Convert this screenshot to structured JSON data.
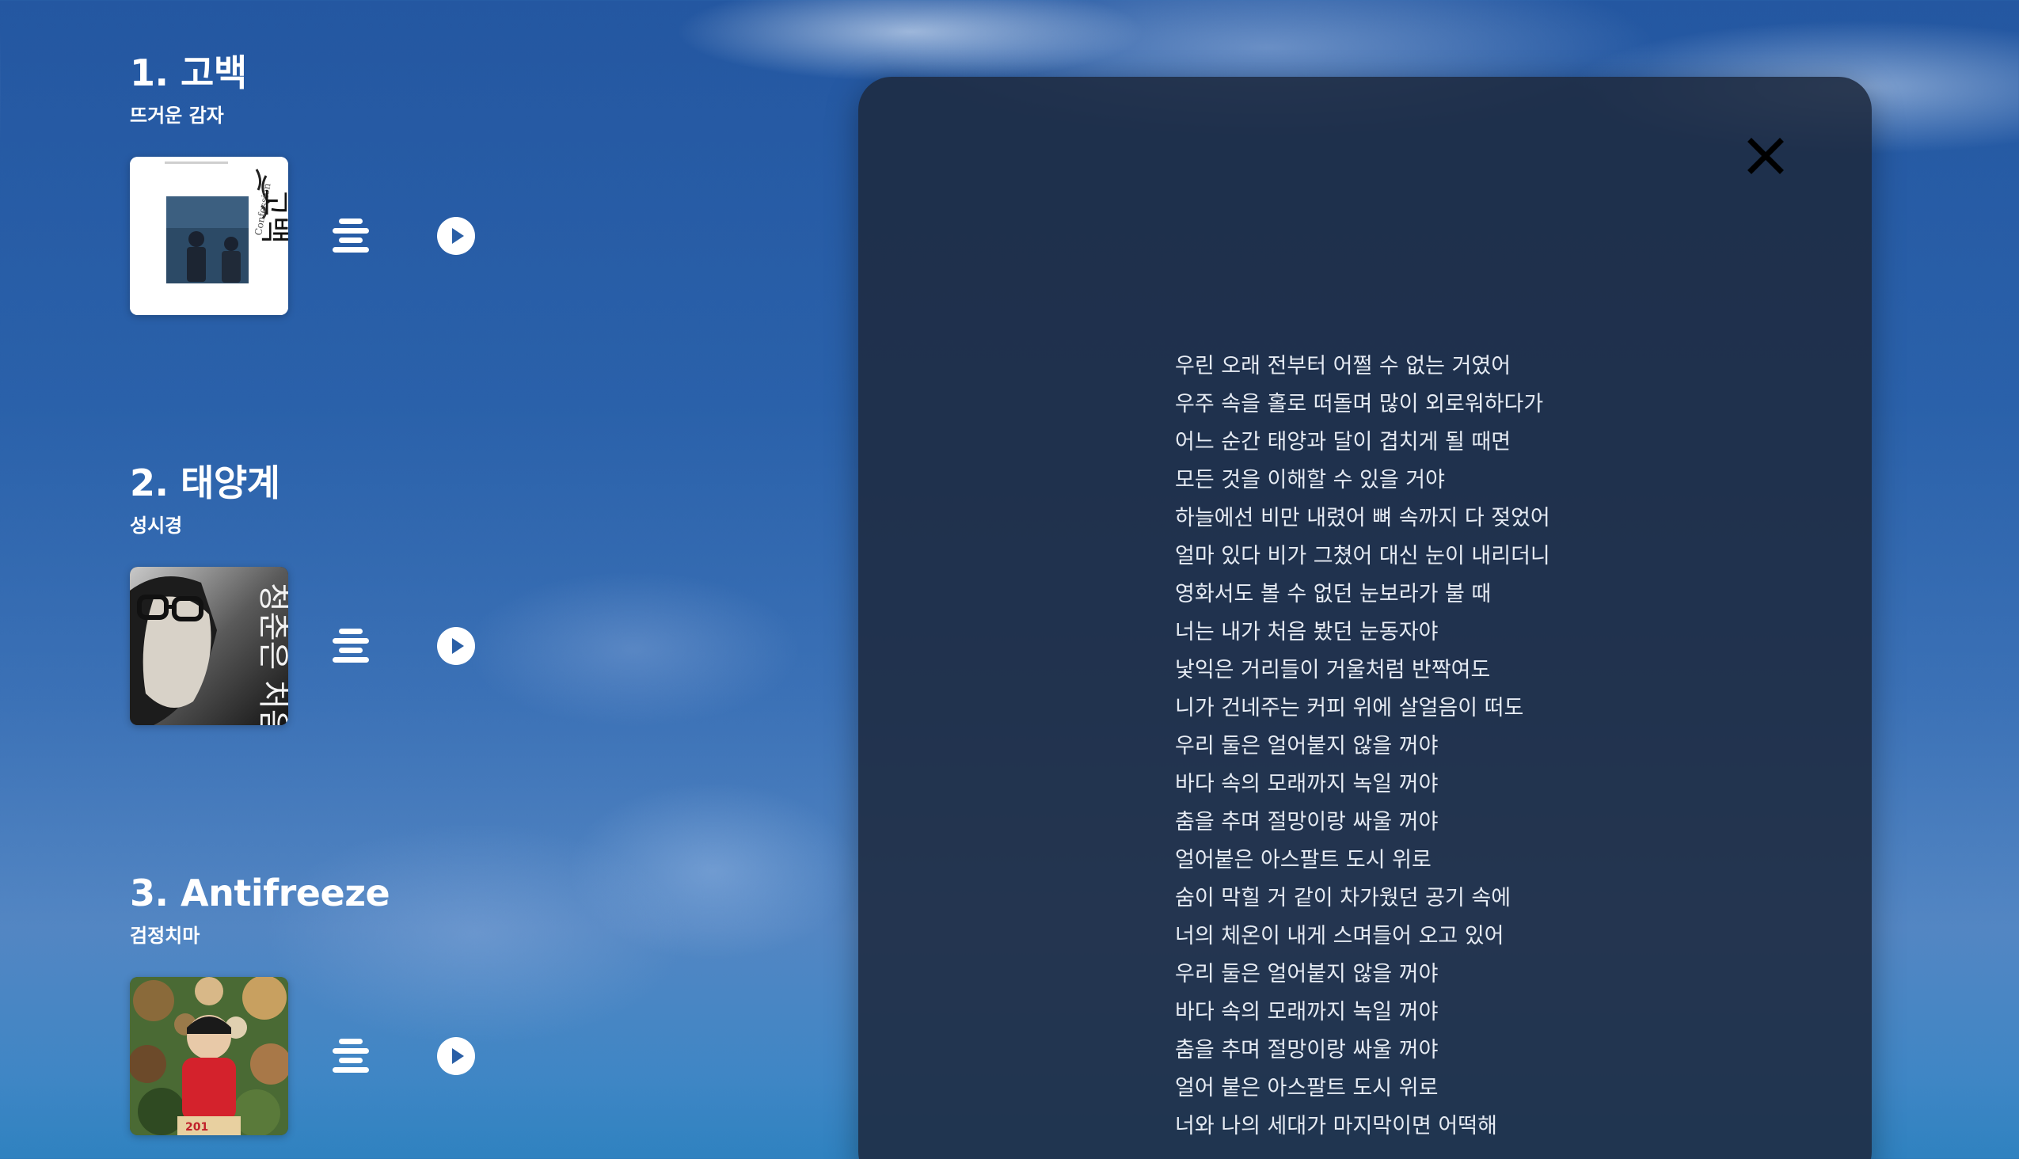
{
  "songs": [
    {
      "title": "1. 고백",
      "artist": "뜨거운 감자",
      "album_text": "고백",
      "album_subtext": "Confession",
      "lyrics_icon": "lyrics-lines-icon",
      "play_icon": "play-icon"
    },
    {
      "title": "2. 태양계",
      "artist": "성시경",
      "album_text": "청춘은 처음",
      "lyrics_icon": "lyrics-lines-icon",
      "play_icon": "play-icon"
    },
    {
      "title": "3. Antifreeze",
      "artist": "검정치마",
      "album_text": "201",
      "lyrics_icon": "lyrics-lines-icon",
      "play_icon": "play-icon"
    }
  ],
  "lyrics_panel": {
    "close_icon": "close-icon",
    "lines": [
      "우린 오래 전부터 어쩔 수 없는 거였어",
      "우주 속을 홀로 떠돌며 많이 외로워하다가",
      "어느 순간 태양과 달이 겹치게 될 때면",
      "모든 것을 이해할 수 있을 거야",
      "하늘에선 비만 내렸어 뼈 속까지 다 젖었어",
      "얼마 있다 비가 그쳤어 대신 눈이 내리더니",
      "영화서도 볼 수 없던 눈보라가 불 때",
      "너는 내가 처음 봤던 눈동자야",
      "낯익은 거리들이 거울처럼 반짝여도",
      "니가 건네주는 커피 위에 살얼음이 떠도",
      "우리 둘은 얼어붙지 않을 꺼야",
      "바다 속의 모래까지 녹일 꺼야",
      "춤을 추며 절망이랑 싸울 꺼야",
      "얼어붙은 아스팔트 도시 위로",
      "숨이 막힐 거 같이 차가웠던 공기 속에",
      "너의 체온이 내게 스며들어 오고 있어",
      "우리 둘은 얼어붙지 않을 꺼야",
      "바다 속의 모래까지 녹일 꺼야",
      "춤을 추며 절망이랑 싸울 꺼야",
      "얼어 붙은 아스팔트 도시 위로",
      "너와 나의 세대가 마지막이면 어떡해"
    ]
  },
  "colors": {
    "panel_background": "#1e2a40",
    "lyrics_text": "#e6ebf3",
    "close_icon": "#000000",
    "icon_white": "#ffffff",
    "play_triangle": "#2a5fa6"
  }
}
